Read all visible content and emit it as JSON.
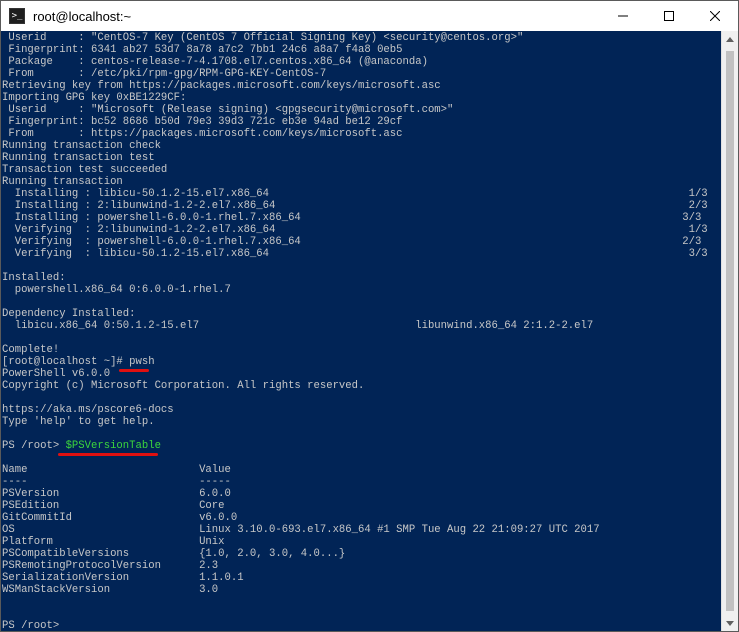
{
  "window": {
    "title": "root@localhost:~",
    "app_icon_glyph": ">_",
    "minimize_label": "minimize",
    "maximize_label": "maximize",
    "close_label": "close"
  },
  "terminal": {
    "lines": [
      " Userid     : \"CentOS-7 Key (CentOS 7 Official Signing Key) <security@centos.org>\"",
      " Fingerprint: 6341 ab27 53d7 8a78 a7c2 7bb1 24c6 a8a7 f4a8 0eb5",
      " Package    : centos-release-7-4.1708.el7.centos.x86_64 (@anaconda)",
      " From       : /etc/pki/rpm-gpg/RPM-GPG-KEY-CentOS-7",
      "Retrieving key from https://packages.microsoft.com/keys/microsoft.asc",
      "Importing GPG key 0xBE1229CF:",
      " Userid     : \"Microsoft (Release signing) <gpgsecurity@microsoft.com>\"",
      " Fingerprint: bc52 8686 b50d 79e3 39d3 721c eb3e 94ad be12 29cf",
      " From       : https://packages.microsoft.com/keys/microsoft.asc",
      "Running transaction check",
      "Running transaction test",
      "Transaction test succeeded",
      "Running transaction",
      "  Installing : libicu-50.1.2-15.el7.x86_64                                                                  1/3",
      "  Installing : 2:libunwind-1.2-2.el7.x86_64                                                                 2/3",
      "  Installing : powershell-6.0.0-1.rhel.7.x86_64                                                            3/3",
      "  Verifying  : 2:libunwind-1.2-2.el7.x86_64                                                                 1/3",
      "  Verifying  : powershell-6.0.0-1.rhel.7.x86_64                                                            2/3",
      "  Verifying  : libicu-50.1.2-15.el7.x86_64                                                                  3/3",
      "",
      "Installed:",
      "  powershell.x86_64 0:6.0.0-1.rhel.7",
      "",
      "Dependency Installed:",
      "  libicu.x86_64 0:50.1.2-15.el7                                  libunwind.x86_64 2:1.2-2.el7",
      "",
      "Complete!",
      "[root@localhost ~]# pwsh",
      "PowerShell v6.0.0",
      "Copyright (c) Microsoft Corporation. All rights reserved.",
      "",
      "https://aka.ms/pscore6-docs",
      "Type 'help' to get help.",
      "",
      "PS /root> ",
      "",
      "Name                           Value",
      "----                           -----",
      "PSVersion                      6.0.0",
      "PSEdition                      Core",
      "GitCommitId                    v6.0.0",
      "OS                             Linux 3.10.0-693.el7.x86_64 #1 SMP Tue Aug 22 21:09:27 UTC 2017",
      "Platform                       Unix",
      "PSCompatibleVersions           {1.0, 2.0, 3.0, 4.0...}",
      "PSRemotingProtocolVersion      2.3",
      "SerializationVersion           1.1.0.1",
      "WSManStackVersion              3.0",
      "",
      "",
      "PS /root>"
    ],
    "command_highlight": "$PSVersionTable"
  },
  "colors": {
    "terminal_bg": "#012456",
    "text": "#c8c8c8",
    "command_green": "#3cd63c",
    "annotation_red": "#e01010"
  }
}
